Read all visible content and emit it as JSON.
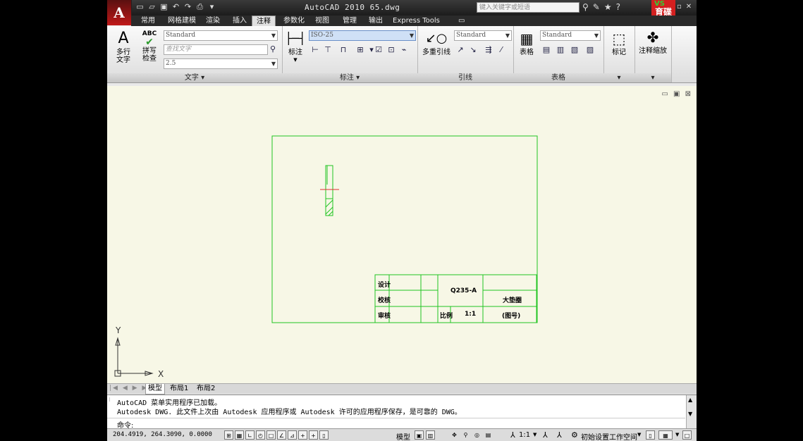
{
  "window": {
    "title": "AutoCAD 2010   65.dwg",
    "search_placeholder": "键入关键字或短语",
    "app_logo": "A",
    "brand_top": "VS",
    "brand_text": "育碟教育"
  },
  "tabs": [
    "常用",
    "网格建模",
    "渲染",
    "插入",
    "注释",
    "参数化",
    "视图",
    "管理",
    "输出",
    "Express Tools"
  ],
  "active_tab": "注释",
  "ribbon": {
    "text_panel": {
      "title": "文字",
      "multiline_label": "多行\n文字",
      "spell_label": "拼写\n检查",
      "spell_icon_text": "ABC",
      "style_value": "Standard",
      "find_placeholder": "查找文字",
      "height_value": "2.5"
    },
    "dim_panel": {
      "title": "标注",
      "dim_label": "标注",
      "dimstyle_value": "ISO-25"
    },
    "leader_panel": {
      "title": "引线",
      "mleader_label": "多重引线",
      "style_value": "Standard"
    },
    "table_panel": {
      "title": "表格",
      "table_label": "表格",
      "style_value": "Standard"
    },
    "markup_panel": {
      "label": "标记"
    },
    "scale_panel": {
      "label": "注释缩放"
    }
  },
  "title_block": {
    "designer_label": "设计",
    "checker_label": "校核",
    "reviewer_label": "审核",
    "material": "Q235-A",
    "part_name": "大垫圈",
    "scale_label": "比例",
    "scale_value": "1:1",
    "drawing_no": "(图号)"
  },
  "ucs": {
    "x_label": "X",
    "y_label": "Y"
  },
  "layout_tabs": [
    "模型",
    "布局1",
    "布局2"
  ],
  "command": {
    "line1": "AutoCAD 菜单实用程序已加载。",
    "line2": "Autodesk DWG.  此文件上次由 Autodesk 应用程序或 Autodesk 许可的应用程序保存，是可靠的 DWG。",
    "prompt": "命令:"
  },
  "status": {
    "coords": "204.4919, 264.3090, 0.0000",
    "model_label": "模型",
    "scale_label": "1:1",
    "workspace_label": "初始设置工作空间"
  },
  "colors": {
    "drawing_bg": "#f7f7e6",
    "border_green": "#22c422",
    "center_red": "#e03030"
  }
}
